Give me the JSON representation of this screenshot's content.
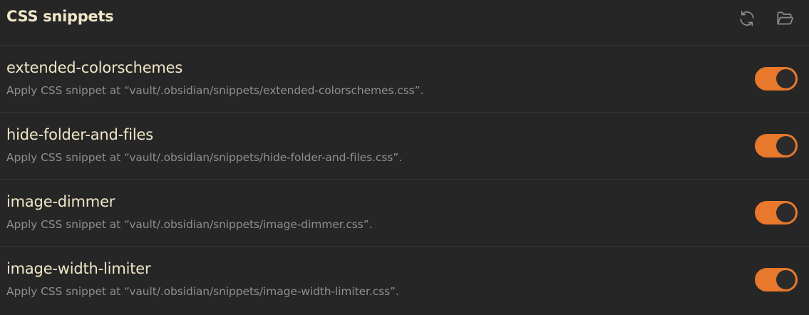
{
  "header": {
    "title": "CSS snippets",
    "actions": [
      {
        "icon": "reload-icon"
      },
      {
        "icon": "folder-open-icon"
      }
    ]
  },
  "colors": {
    "accent": "#e8782c",
    "background": "#262626",
    "title_text": "#f0e6c8",
    "description_text": "#8e8e8e"
  },
  "snippets": [
    {
      "name": "extended-colorschemes",
      "description": "Apply CSS snippet at “vault/.obsidian/snippets/extended-colorschemes.css”.",
      "enabled": true
    },
    {
      "name": "hide-folder-and-files",
      "description": "Apply CSS snippet at “vault/.obsidian/snippets/hide-folder-and-files.css”.",
      "enabled": true
    },
    {
      "name": "image-dimmer",
      "description": "Apply CSS snippet at “vault/.obsidian/snippets/image-dimmer.css”.",
      "enabled": true
    },
    {
      "name": "image-width-limiter",
      "description": "Apply CSS snippet at “vault/.obsidian/snippets/image-width-limiter.css”.",
      "enabled": true
    }
  ]
}
